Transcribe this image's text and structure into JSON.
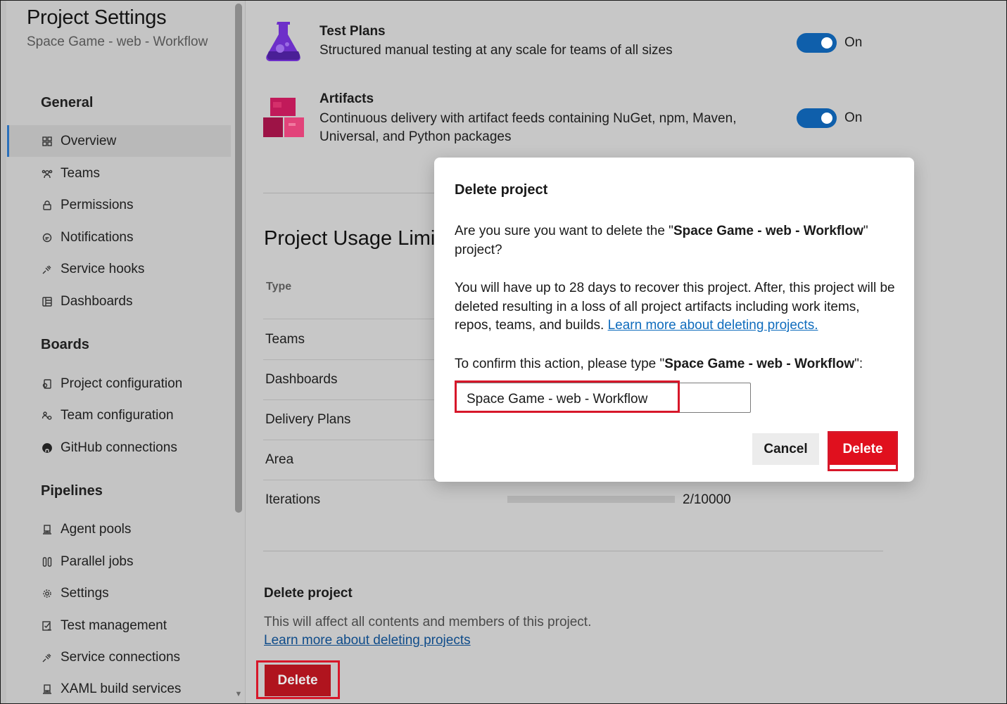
{
  "sidebar": {
    "title": "Project Settings",
    "subtitle": "Space Game - web - Workflow",
    "sections": [
      {
        "label": "General",
        "items": [
          {
            "label": "Overview",
            "icon": "overview-icon",
            "selected": true
          },
          {
            "label": "Teams",
            "icon": "teams-icon"
          },
          {
            "label": "Permissions",
            "icon": "lock-icon"
          },
          {
            "label": "Notifications",
            "icon": "chat-icon"
          },
          {
            "label": "Service hooks",
            "icon": "plug-icon"
          },
          {
            "label": "Dashboards",
            "icon": "dashboard-icon"
          }
        ]
      },
      {
        "label": "Boards",
        "items": [
          {
            "label": "Project configuration",
            "icon": "project-config-icon"
          },
          {
            "label": "Team configuration",
            "icon": "team-config-icon"
          },
          {
            "label": "GitHub connections",
            "icon": "github-icon"
          }
        ]
      },
      {
        "label": "Pipelines",
        "items": [
          {
            "label": "Agent pools",
            "icon": "agent-pool-icon"
          },
          {
            "label": "Parallel jobs",
            "icon": "parallel-icon"
          },
          {
            "label": "Settings",
            "icon": "gear-icon"
          },
          {
            "label": "Test management",
            "icon": "test-management-icon"
          },
          {
            "label": "Service connections",
            "icon": "plug-icon"
          },
          {
            "label": "XAML build services",
            "icon": "agent-pool-icon"
          }
        ]
      }
    ]
  },
  "services": [
    {
      "title": "Test Plans",
      "description": "Structured manual testing at any scale for teams of all sizes",
      "toggle": "On",
      "enabled": true,
      "icon": "test-plans-flask-icon"
    },
    {
      "title": "Artifacts",
      "description": "Continuous delivery with artifact feeds containing NuGet, npm, Maven, Universal, and Python packages",
      "toggle": "On",
      "enabled": true,
      "icon": "artifacts-boxes-icon"
    }
  ],
  "usage": {
    "title": "Project Usage Limit",
    "column_type": "Type",
    "rows": [
      "Teams",
      "Dashboards",
      "Delivery Plans",
      "Area",
      "Iterations"
    ],
    "iterations_value": "2/10000",
    "iterations_fraction": 0.0002
  },
  "delete_section": {
    "title": "Delete project",
    "description": "This will affect all contents and members of this project.",
    "link": "Learn more about deleting projects",
    "button": "Delete"
  },
  "dialog": {
    "title": "Delete project",
    "q_prefix": "Are you sure you want to delete the \"",
    "project_name": "Space Game - web - Workflow",
    "q_suffix": "\" project?",
    "warning": "You will have up to 28 days to recover this project. After, this project will be deleted resulting in a loss of all project artifacts including work items, repos, teams, and builds.",
    "warning_link": "Learn more about deleting projects.",
    "confirm_prefix": "To confirm this action, please type \"",
    "confirm_suffix": "\":",
    "input_value": "Space Game - web - Workflow",
    "cancel": "Cancel",
    "delete": "Delete"
  },
  "colors": {
    "highlight": "#d7172a",
    "toggle_on": "#0f5fab",
    "danger": "#e0101e",
    "link": "#0f6cbd"
  }
}
